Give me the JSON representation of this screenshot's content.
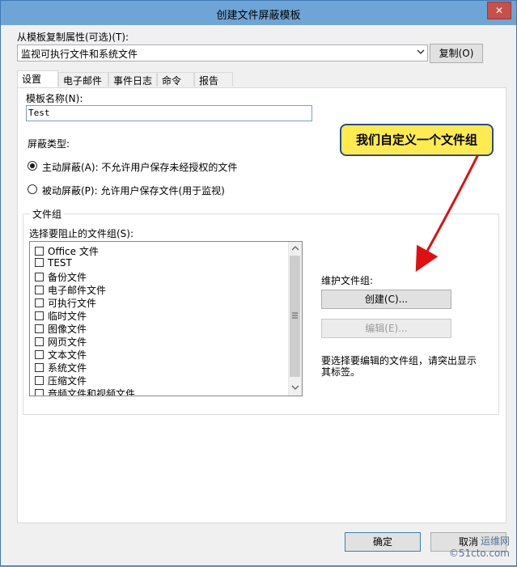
{
  "window": {
    "title": "创建文件屏蔽模板",
    "close_symbol": "✕"
  },
  "copy_from": {
    "label": "从模板复制属性(可选)(T):",
    "selected": "监视可执行文件和系统文件",
    "copy_button": "复制(O)"
  },
  "tabs": [
    {
      "label": "设置",
      "active": true
    },
    {
      "label": "电子邮件"
    },
    {
      "label": "事件日志"
    },
    {
      "label": "命令"
    },
    {
      "label": "报告"
    }
  ],
  "settings": {
    "template_name_label": "模板名称(N):",
    "template_name_value": "Test",
    "screen_type_label": "屏蔽类型:",
    "active_option": "主动屏蔽(A): 不允许用户保存未经授权的文件",
    "passive_option": "被动屏蔽(P): 允许用户保存文件(用于监视)",
    "active_selected": true
  },
  "file_groups": {
    "group_caption": "文件组",
    "list_label": "选择要阻止的文件组(S):",
    "items": [
      "Office 文件",
      "TEST",
      "备份文件",
      "电子邮件文件",
      "可执行文件",
      "临时文件",
      "图像文件",
      "网页文件",
      "文本文件",
      "系统文件",
      "压缩文件",
      "音频文件和视频文件"
    ],
    "maintain_label": "维护文件组:",
    "create_button": "创建(C)...",
    "edit_button": "编辑(E)...",
    "hint": "要选择要编辑的文件组，请突出显示其标签。"
  },
  "callout": {
    "text": "我们自定义一个文件组",
    "colors": {
      "fill": "#ffeb4f",
      "border": "#2c4d8a",
      "arrow": "#e01010"
    }
  },
  "footer": {
    "ok_button": "确定",
    "cancel_button": "取消"
  },
  "watermark": {
    "line1": "运维网",
    "line2": "©51cto.com"
  }
}
